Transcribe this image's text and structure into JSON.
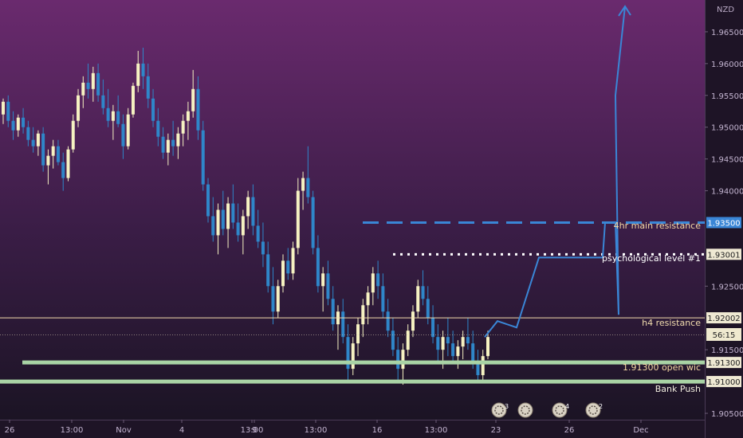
{
  "chart_data": {
    "type": "candlestick",
    "symbol_currency": "NZD",
    "y_axis": {
      "range": [
        1.904,
        1.97
      ],
      "ticks": [
        "1.96500",
        "1.96000",
        "1.95500",
        "1.95000",
        "1.94500",
        "1.94000",
        "1.93500",
        "1.93001",
        "1.92500",
        "1.92002",
        "1.91500",
        "1.91300",
        "1.91000",
        "1.90500"
      ]
    },
    "x_axis": {
      "ticks": [
        "26",
        "13:00",
        "Nov",
        "4",
        "13:00",
        "9",
        "13:00",
        "16",
        "13:00",
        "23",
        "26",
        "Dec"
      ]
    },
    "current_price_label": "56:15",
    "levels": [
      {
        "name": "4hr main resistance",
        "price": 1.935,
        "axis_label": "1.93500",
        "style": "dashed",
        "color": "#3a86d6"
      },
      {
        "name": "psychological level #1",
        "price": 1.93001,
        "axis_label": "1.93001",
        "style": "dotted",
        "color": "#ffffff"
      },
      {
        "name": "h4 resistance",
        "price": 1.92002,
        "axis_label": "1.92002",
        "style": "solid-thin",
        "color": "#f2dcae"
      },
      {
        "name": "1.91300 open wic",
        "price": 1.913,
        "axis_label": "1.91300",
        "style": "solid-thick",
        "color": "#a9d3a5"
      },
      {
        "name": "Bank Push",
        "price": 1.91,
        "axis_label": "1.91000",
        "style": "solid-thick",
        "color": "#a9d3a5"
      }
    ],
    "projection_path_prices": [
      1.917,
      1.9195,
      1.9185,
      1.9295,
      1.9295,
      1.9295,
      1.935,
      1.935,
      1.9205,
      1.955,
      1.969
    ],
    "event_icons": [
      {
        "badge": "3"
      },
      {
        "badge": ""
      },
      {
        "badge": "4"
      },
      {
        "badge": "2"
      }
    ],
    "colors": {
      "up_candle": "#f6f2c2",
      "down_candle": "#2f86c9",
      "projection": "#3a86d6",
      "axis_text": "#b8a9c4"
    },
    "grid": false,
    "candles": [
      [
        1.952,
        1.9545,
        1.9505,
        1.954
      ],
      [
        1.954,
        1.955,
        1.95,
        1.951
      ],
      [
        1.951,
        1.9525,
        1.948,
        1.9495
      ],
      [
        1.9495,
        1.952,
        1.9485,
        1.9515
      ],
      [
        1.9515,
        1.953,
        1.949,
        1.95
      ],
      [
        1.95,
        1.951,
        1.947,
        1.948
      ],
      [
        1.948,
        1.95,
        1.946,
        1.947
      ],
      [
        1.947,
        1.9495,
        1.9455,
        1.949
      ],
      [
        1.949,
        1.95,
        1.943,
        1.944
      ],
      [
        1.944,
        1.9465,
        1.941,
        1.9455
      ],
      [
        1.9455,
        1.948,
        1.9435,
        1.947
      ],
      [
        1.947,
        1.948,
        1.944,
        1.9445
      ],
      [
        1.9445,
        1.946,
        1.94,
        1.942
      ],
      [
        1.942,
        1.947,
        1.9415,
        1.9465
      ],
      [
        1.9465,
        1.952,
        1.946,
        1.951
      ],
      [
        1.951,
        1.956,
        1.95,
        1.955
      ],
      [
        1.955,
        1.958,
        1.953,
        1.957
      ],
      [
        1.957,
        1.96,
        1.9545,
        1.956
      ],
      [
        1.956,
        1.9595,
        1.954,
        1.9585
      ],
      [
        1.9585,
        1.96,
        1.954,
        1.955
      ],
      [
        1.955,
        1.9575,
        1.952,
        1.953
      ],
      [
        1.953,
        1.956,
        1.95,
        1.951
      ],
      [
        1.951,
        1.9535,
        1.948,
        1.9525
      ],
      [
        1.9525,
        1.955,
        1.95,
        1.9505
      ],
      [
        1.9505,
        1.952,
        1.945,
        1.947
      ],
      [
        1.947,
        1.953,
        1.9465,
        1.952
      ],
      [
        1.952,
        1.957,
        1.9515,
        1.9565
      ],
      [
        1.9565,
        1.962,
        1.9555,
        1.96
      ],
      [
        1.96,
        1.9625,
        1.956,
        1.958
      ],
      [
        1.958,
        1.96,
        1.953,
        1.9545
      ],
      [
        1.9545,
        1.956,
        1.95,
        1.951
      ],
      [
        1.951,
        1.953,
        1.947,
        1.9485
      ],
      [
        1.9485,
        1.95,
        1.945,
        1.946
      ],
      [
        1.946,
        1.949,
        1.944,
        1.948
      ],
      [
        1.948,
        1.951,
        1.9455,
        1.947
      ],
      [
        1.947,
        1.95,
        1.945,
        1.949
      ],
      [
        1.949,
        1.952,
        1.947,
        1.951
      ],
      [
        1.951,
        1.954,
        1.948,
        1.9525
      ],
      [
        1.9525,
        1.959,
        1.9515,
        1.956
      ],
      [
        1.956,
        1.958,
        1.948,
        1.9495
      ],
      [
        1.9495,
        1.951,
        1.94,
        1.941
      ],
      [
        1.941,
        1.942,
        1.935,
        1.936
      ],
      [
        1.936,
        1.939,
        1.932,
        1.933
      ],
      [
        1.933,
        1.938,
        1.93,
        1.937
      ],
      [
        1.937,
        1.94,
        1.933,
        1.934
      ],
      [
        1.934,
        1.939,
        1.931,
        1.938
      ],
      [
        1.938,
        1.941,
        1.934,
        1.935
      ],
      [
        1.935,
        1.938,
        1.932,
        1.933
      ],
      [
        1.933,
        1.937,
        1.93,
        1.936
      ],
      [
        1.936,
        1.94,
        1.934,
        1.939
      ],
      [
        1.939,
        1.941,
        1.933,
        1.9345
      ],
      [
        1.9345,
        1.937,
        1.931,
        1.932
      ],
      [
        1.932,
        1.935,
        1.928,
        1.93
      ],
      [
        1.93,
        1.932,
        1.924,
        1.925
      ],
      [
        1.925,
        1.928,
        1.919,
        1.921
      ],
      [
        1.921,
        1.926,
        1.92,
        1.925
      ],
      [
        1.925,
        1.93,
        1.924,
        1.929
      ],
      [
        1.929,
        1.931,
        1.926,
        1.927
      ],
      [
        1.927,
        1.932,
        1.926,
        1.931
      ],
      [
        1.931,
        1.942,
        1.93,
        1.94
      ],
      [
        1.94,
        1.943,
        1.937,
        1.942
      ],
      [
        1.942,
        1.947,
        1.938,
        1.939
      ],
      [
        1.939,
        1.94,
        1.93,
        1.931
      ],
      [
        1.931,
        1.933,
        1.924,
        1.925
      ],
      [
        1.925,
        1.928,
        1.921,
        1.927
      ],
      [
        1.927,
        1.929,
        1.922,
        1.923
      ],
      [
        1.923,
        1.925,
        1.918,
        1.919
      ],
      [
        1.919,
        1.922,
        1.915,
        1.921
      ],
      [
        1.921,
        1.923,
        1.916,
        1.917
      ],
      [
        1.917,
        1.919,
        1.91,
        1.912
      ],
      [
        1.912,
        1.917,
        1.911,
        1.916
      ],
      [
        1.916,
        1.92,
        1.914,
        1.919
      ],
      [
        1.919,
        1.923,
        1.917,
        1.922
      ],
      [
        1.922,
        1.925,
        1.919,
        1.924
      ],
      [
        1.924,
        1.928,
        1.922,
        1.927
      ],
      [
        1.927,
        1.929,
        1.923,
        1.925
      ],
      [
        1.925,
        1.927,
        1.92,
        1.921
      ],
      [
        1.921,
        1.923,
        1.917,
        1.918
      ],
      [
        1.918,
        1.92,
        1.914,
        1.915
      ],
      [
        1.915,
        1.917,
        1.91,
        1.912
      ],
      [
        1.912,
        1.916,
        1.9095,
        1.915
      ],
      [
        1.915,
        1.919,
        1.914,
        1.918
      ],
      [
        1.918,
        1.922,
        1.917,
        1.921
      ],
      [
        1.921,
        1.926,
        1.92,
        1.925
      ],
      [
        1.925,
        1.9275,
        1.922,
        1.923
      ],
      [
        1.923,
        1.925,
        1.919,
        1.92
      ],
      [
        1.92,
        1.922,
        1.916,
        1.917
      ],
      [
        1.917,
        1.919,
        1.913,
        1.915
      ],
      [
        1.915,
        1.918,
        1.912,
        1.917
      ],
      [
        1.917,
        1.92,
        1.914,
        1.916
      ],
      [
        1.916,
        1.918,
        1.913,
        1.914
      ],
      [
        1.914,
        1.9165,
        1.912,
        1.9155
      ],
      [
        1.9155,
        1.918,
        1.9135,
        1.917
      ],
      [
        1.917,
        1.92,
        1.915,
        1.916
      ],
      [
        1.916,
        1.918,
        1.912,
        1.913
      ],
      [
        1.913,
        1.915,
        1.91,
        1.911
      ],
      [
        1.911,
        1.915,
        1.91,
        1.914
      ],
      [
        1.914,
        1.918,
        1.9135,
        1.917
      ]
    ]
  }
}
